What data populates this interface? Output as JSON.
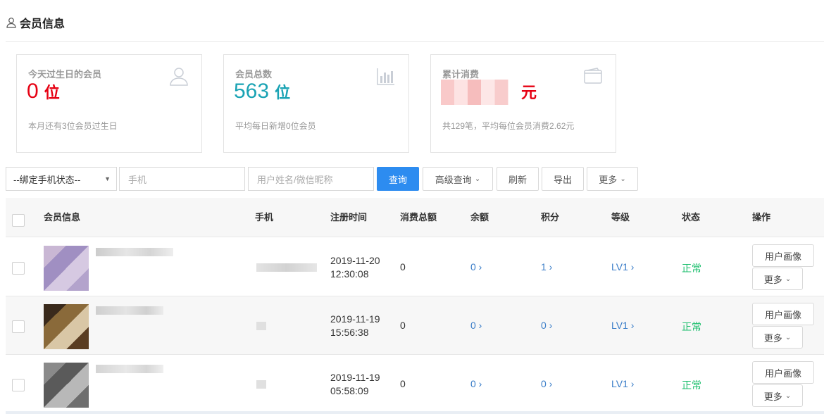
{
  "page": {
    "title": "会员信息",
    "icon": "user-icon"
  },
  "cards": [
    {
      "label": "今天过生日的会员",
      "value": "0",
      "unit": "位",
      "note": "本月还有3位会员过生日",
      "icon": "user-icon",
      "color": "#e60012"
    },
    {
      "label": "会员总数",
      "value": "563",
      "unit": "位",
      "note": "平均每日新增0位会员",
      "icon": "bar-chart-icon",
      "color": "#1aa3b4"
    },
    {
      "label": "累计消费",
      "value": "",
      "unit": "元",
      "note": "共129笔，平均每位会员消费2.62元",
      "icon": "wallet-icon",
      "color": "#e60012"
    }
  ],
  "filters": {
    "phone_status": "--绑定手机状态--",
    "phone_placeholder": "手机",
    "name_placeholder": "用户姓名/微信昵称",
    "search": "查询",
    "advanced": "高级查询",
    "refresh": "刷新",
    "export": "导出",
    "more": "更多"
  },
  "table": {
    "columns": [
      "会员信息",
      "手机",
      "注册时间",
      "消费总额",
      "余额",
      "积分",
      "等级",
      "状态",
      "操作"
    ],
    "rows": [
      {
        "reg_date": "2019-11-20",
        "reg_time": "12:30:08",
        "total": "0",
        "balance": "0 ›",
        "points": "1 ›",
        "level": "LV1 ›",
        "status": "正常"
      },
      {
        "reg_date": "2019-11-19",
        "reg_time": "15:56:38",
        "total": "0",
        "balance": "0 ›",
        "points": "0 ›",
        "level": "LV1 ›",
        "status": "正常"
      },
      {
        "reg_date": "2019-11-19",
        "reg_time": "05:58:09",
        "total": "0",
        "balance": "0 ›",
        "points": "0 ›",
        "level": "LV1 ›",
        "status": "正常"
      }
    ],
    "row_actions": {
      "portrait": "用户画像",
      "more": "更多"
    }
  },
  "colors": {
    "primary": "#2d8cf0",
    "link": "#3a7dc8",
    "ok": "#19be6b",
    "red": "#e60012",
    "teal": "#1aa3b4"
  }
}
